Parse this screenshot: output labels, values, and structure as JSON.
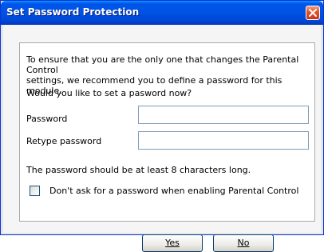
{
  "window": {
    "title": "Set Password Protection"
  },
  "panel": {
    "intro_line1": "To ensure that you are the only one that changes the Parental Control",
    "intro_line2": "settings, we recommend you to define a password for this module.",
    "question": "Would you like to set a pasword now?",
    "password_label": "Password",
    "retype_label": "Retype password",
    "password_value": "",
    "retype_value": "",
    "hint": "The password should be at least 8 characters long.",
    "checkbox_label": "Don't ask for a password when enabling Parental Control",
    "checkbox_checked": false
  },
  "buttons": {
    "yes_label": "Yes",
    "no_label": "No"
  },
  "colors": {
    "titlebar": "#0055ea",
    "close": "#e1512a",
    "panel_border": "#a9a9a9"
  },
  "icons": {
    "close": "close-icon"
  }
}
